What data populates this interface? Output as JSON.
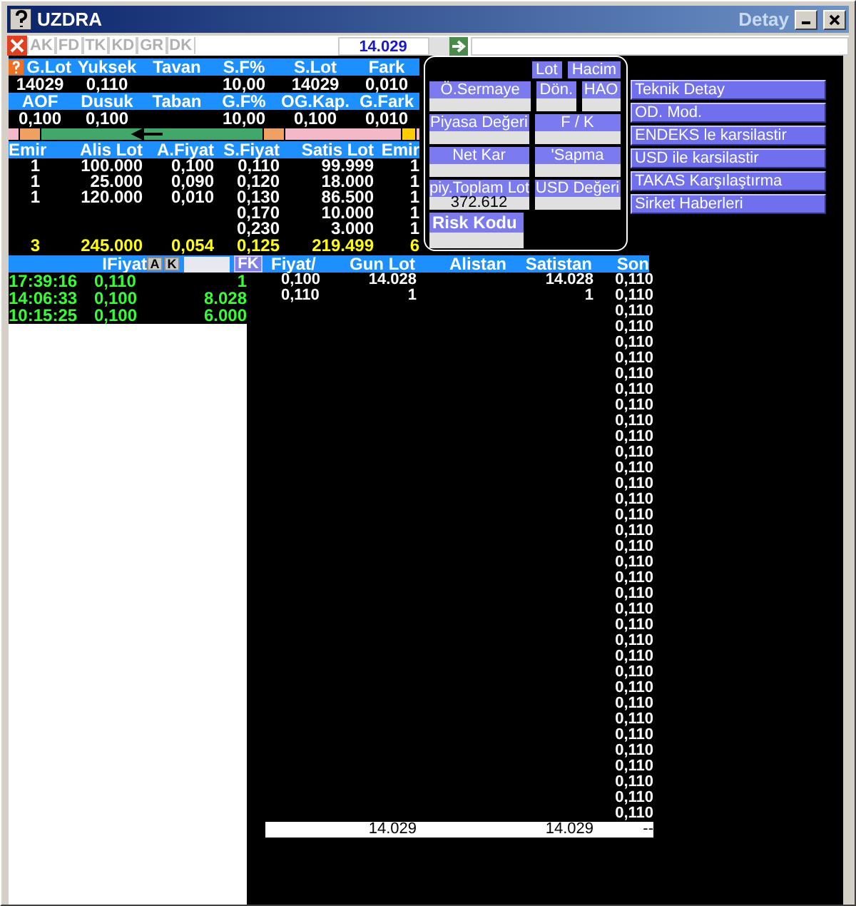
{
  "window": {
    "title": "UZDRA",
    "detail_title": "Detay"
  },
  "toolbar": {
    "tabs": [
      "AK",
      "FD",
      "TK",
      "KD",
      "GR",
      "DK"
    ],
    "value": "14.029"
  },
  "summary": [
    [
      {
        "header": "G.Lot",
        "value": "14029"
      },
      {
        "header": "Yuksek",
        "value": "0,110"
      },
      {
        "header": "Tavan"
      },
      {
        "header": "S.F%",
        "value": "10,00"
      },
      {
        "header": "S.Lot",
        "value": "14029"
      },
      {
        "header": "Fark",
        "value": "0,010"
      }
    ],
    [
      {
        "header": "AOF",
        "value": "0,100"
      },
      {
        "header": "Dusuk",
        "value": "0,100"
      },
      {
        "header": "Taban"
      },
      {
        "header": "G.F%",
        "value": "10,00"
      },
      {
        "header": "OG.Kap.",
        "value": "0,100"
      },
      {
        "header": "G.Fark",
        "value": "0,010"
      }
    ]
  ],
  "depth": {
    "columns": [
      "Emir",
      "Alis Lot",
      "A.Fiyat",
      "S.Fiyat",
      "Satis Lot",
      "Emir"
    ],
    "rows": [
      {
        "emir_alis": "1",
        "alis_lot": "100.000",
        "a_fiyat": "0,100",
        "s_fiyat": "0,110",
        "satis_lot": "99.999",
        "emir_satis": "1"
      },
      {
        "emir_alis": "1",
        "alis_lot": "25.000",
        "a_fiyat": "0,090",
        "s_fiyat": "0,120",
        "satis_lot": "18.000",
        "emir_satis": "1"
      },
      {
        "emir_alis": "1",
        "alis_lot": "120.000",
        "a_fiyat": "0,010",
        "s_fiyat": "0,130",
        "satis_lot": "86.500",
        "emir_satis": "1"
      },
      {
        "s_fiyat": "0,170",
        "satis_lot": "10.000",
        "emir_satis": "1"
      },
      {
        "s_fiyat": "0,230",
        "satis_lot": "3.000",
        "emir_satis": "1"
      }
    ],
    "totals": {
      "emir_alis": "3",
      "alis_lot": "245.000",
      "a_fiyat": "0,054",
      "s_fiyat": "0,125",
      "satis_lot": "219.499",
      "emir_satis": "6"
    }
  },
  "detail": {
    "tabs": [
      "Lot",
      "Hacim"
    ],
    "rows": [
      [
        {
          "kind": "field",
          "label": "Ö.Sermaye"
        },
        {
          "kind": "field",
          "label": "Dön."
        },
        {
          "kind": "field",
          "label": "HAO"
        }
      ],
      [
        {
          "kind": "field",
          "label": "Piyasa Değeri"
        },
        {
          "kind": "field",
          "label": "F / K"
        }
      ],
      [
        {
          "kind": "field",
          "label": "Net Kar"
        },
        {
          "kind": "field",
          "label": "'Sapma"
        }
      ],
      [
        {
          "kind": "field",
          "label": "piy.Toplam Lot",
          "value": "372.612"
        },
        {
          "kind": "field",
          "label": "USD Değeri"
        }
      ],
      [
        {
          "kind": "major",
          "label": "Risk Kodu"
        }
      ]
    ]
  },
  "links": [
    "Teknik Detay",
    "OD. Mod.",
    "ENDEKS le karsilastir",
    "USD ile karsilastir",
    "TAKAS Karşılaştırma",
    "Sirket Haberleri"
  ],
  "trades": {
    "header": "IFiyat",
    "buttons": [
      "A",
      "K"
    ],
    "filter": "FK",
    "rows": [
      {
        "time": "17:39:16",
        "price": "0,110",
        "lot": "1"
      },
      {
        "time": "14:06:33",
        "price": "0,100",
        "lot": "8.028"
      },
      {
        "time": "10:15:25",
        "price": "0,100",
        "lot": "6.000"
      }
    ]
  },
  "prices": {
    "columns": [
      "Fiyat/",
      "Gun Lot",
      "Alistan",
      "Satistan",
      "Son"
    ],
    "rows": [
      {
        "fiyat": "0,100",
        "gun_lot": "14.028",
        "satistan": "14.028",
        "son": "0,110"
      },
      {
        "fiyat": "0,110",
        "gun_lot": "1",
        "satistan": "1",
        "son": "0,110"
      },
      {
        "son": "0,110"
      },
      {
        "son": "0,110"
      },
      {
        "son": "0,110"
      },
      {
        "son": "0,110"
      },
      {
        "son": "0,110"
      },
      {
        "son": "0,110"
      },
      {
        "son": "0,110"
      },
      {
        "son": "0,110"
      },
      {
        "son": "0,110"
      },
      {
        "son": "0,110"
      },
      {
        "son": "0,110"
      },
      {
        "son": "0,110"
      },
      {
        "son": "0,110"
      },
      {
        "son": "0,110"
      },
      {
        "son": "0,110"
      },
      {
        "son": "0,110"
      },
      {
        "son": "0,110"
      },
      {
        "son": "0,110"
      },
      {
        "son": "0,110"
      },
      {
        "son": "0,110"
      },
      {
        "son": "0,110"
      },
      {
        "son": "0,110"
      },
      {
        "son": "0,110"
      },
      {
        "son": "0,110"
      },
      {
        "son": "0,110"
      },
      {
        "son": "0,110"
      },
      {
        "son": "0,110"
      },
      {
        "son": "0,110"
      },
      {
        "son": "0,110"
      },
      {
        "son": "0,110"
      },
      {
        "son": "0,110"
      },
      {
        "son": "0,110"
      },
      {
        "son": "0,110"
      }
    ],
    "footer": {
      "gun_lot": "14.029",
      "satistan": "14.029",
      "son": "--"
    }
  }
}
